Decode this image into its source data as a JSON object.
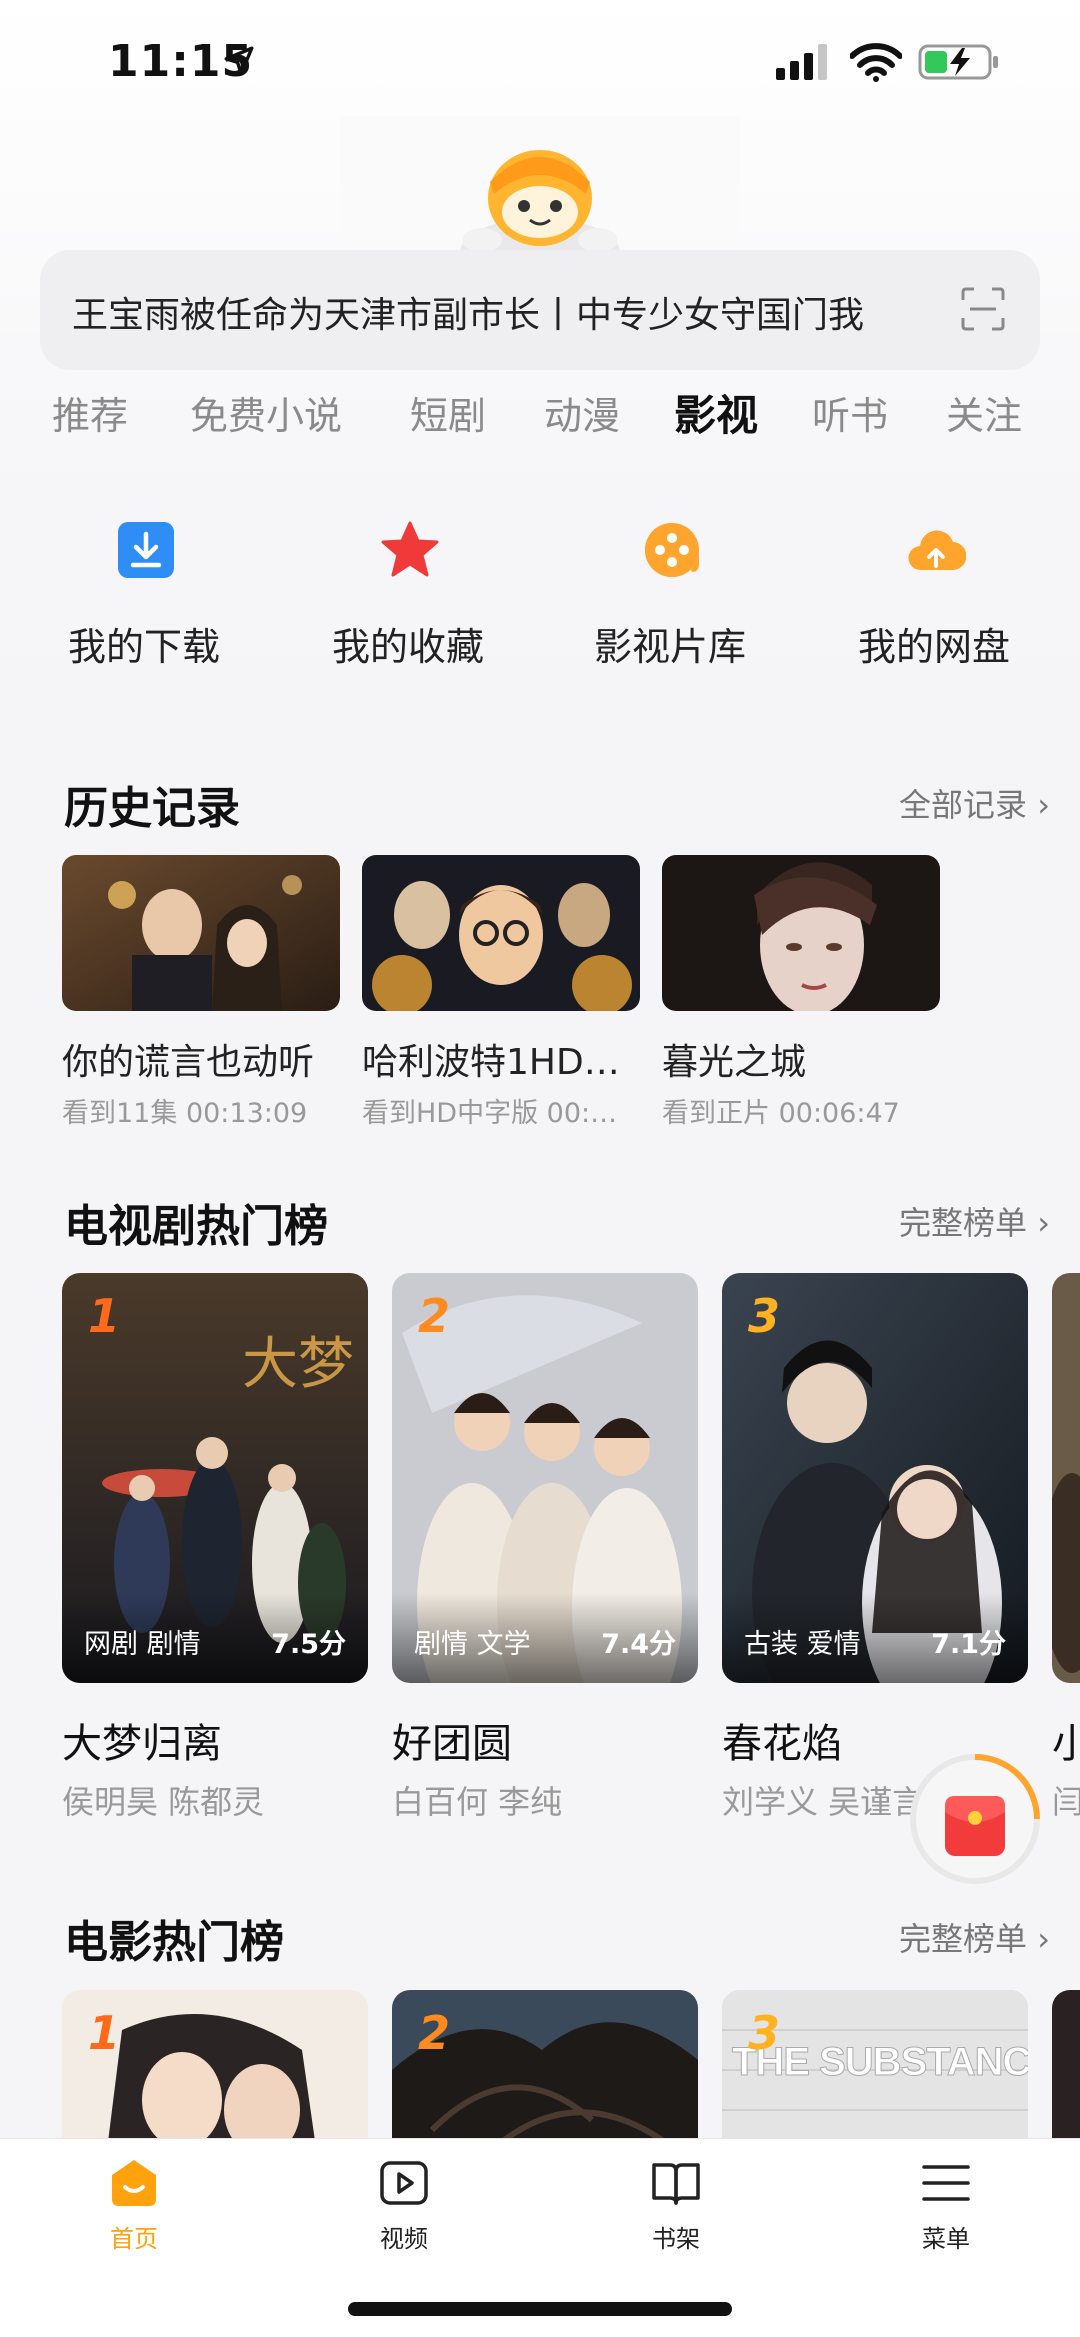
{
  "status_bar": {
    "time": "11:15"
  },
  "search": {
    "text": "王宝雨被任命为天津市副市长丨中专少女守国门我"
  },
  "tabs": [
    "推荐",
    "免费小说",
    "短剧",
    "动漫",
    "影视",
    "听书",
    "关注"
  ],
  "active_tab": "影视",
  "quick_actions": [
    {
      "label": "我的下载",
      "icon": "download-icon",
      "color": "#2f8ef5"
    },
    {
      "label": "我的收藏",
      "icon": "star-icon",
      "color": "#f03a3a"
    },
    {
      "label": "影视片库",
      "icon": "film-reel-icon",
      "color": "#ffa52e"
    },
    {
      "label": "我的网盘",
      "icon": "cloud-upload-icon",
      "color": "#ffa52e"
    }
  ],
  "history": {
    "title": "历史记录",
    "link": "全部记录",
    "items": [
      {
        "name": "你的谎言也动听",
        "progress": "看到11集 00:13:09"
      },
      {
        "name": "哈利波特1HD…",
        "progress": "看到HD中字版 00:…"
      },
      {
        "name": "暮光之城",
        "progress": "看到正片 00:06:47"
      }
    ]
  },
  "tv_rank": {
    "title": "电视剧热门榜",
    "link": "完整榜单",
    "items": [
      {
        "rank": "1",
        "tags": "网剧 剧情",
        "score": "7.5分",
        "title": "大梦归离",
        "cast": "侯明昊 陈都灵"
      },
      {
        "rank": "2",
        "tags": "剧情 文学",
        "score": "7.4分",
        "title": "好团圆",
        "cast": "白百何 李纯"
      },
      {
        "rank": "3",
        "tags": "古装 爱情",
        "score": "7.1分",
        "title": "春花焰",
        "cast": "刘学义 吴谨言"
      },
      {
        "title": "小",
        "cast": "闫"
      }
    ]
  },
  "movie_rank": {
    "title": "电影热门榜",
    "link": "完整榜单",
    "items": [
      {
        "rank": "1"
      },
      {
        "rank": "2"
      },
      {
        "rank": "3",
        "poster_text": "THE SUBSTANCE"
      }
    ]
  },
  "bottom_nav": [
    {
      "label": "首页",
      "icon": "home-icon",
      "active": true
    },
    {
      "label": "视频",
      "icon": "video-play-icon",
      "active": false
    },
    {
      "label": "书架",
      "icon": "book-icon",
      "active": false
    },
    {
      "label": "菜单",
      "icon": "menu-icon",
      "active": false
    }
  ],
  "colors": {
    "accent": "#ffa20d",
    "rank_1": "#ff6a1a",
    "rank_2": "#ff8a1f",
    "rank_3": "#ffb21f"
  }
}
